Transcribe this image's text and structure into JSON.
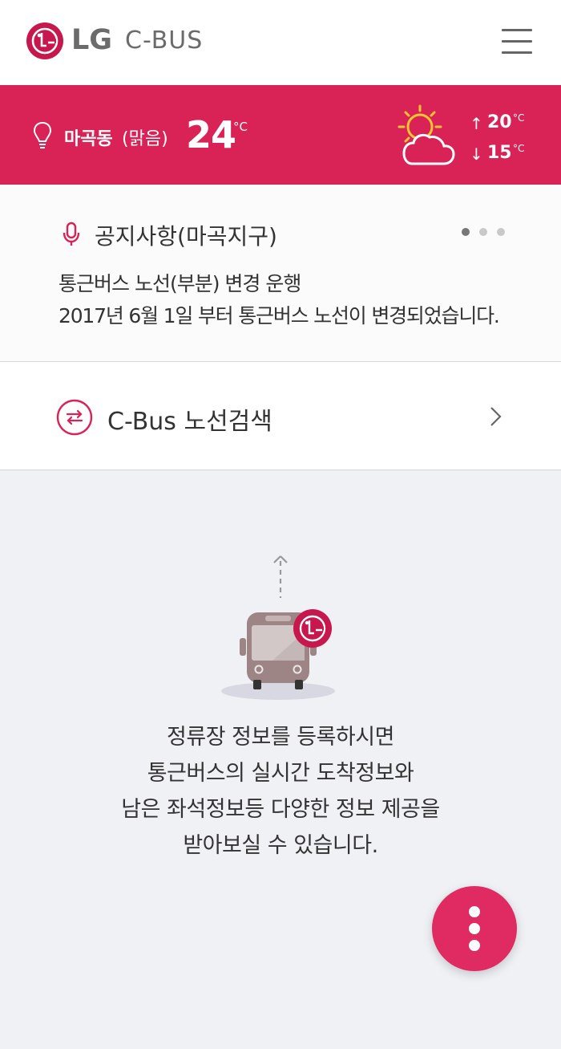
{
  "header": {
    "brand": "LG",
    "app_name": "C-BUS"
  },
  "weather": {
    "location": "마곡동",
    "condition": "(맑음)",
    "temperature": "24",
    "unit": "°C",
    "high": "20",
    "low": "15",
    "high_arrow": "↑",
    "low_arrow": "↓",
    "icon": "partly-cloudy-icon"
  },
  "notice": {
    "title": "공지사항(마곡지구)",
    "line1": "통근버스 노선(부분) 변경 운행",
    "line2": "2017년 6월 1일 부터 통근버스 노선이 변경되었습니다.",
    "pages": 3,
    "active_page": 1
  },
  "route_search": {
    "label": "C-Bus 노선검색"
  },
  "empty_state": {
    "line1": "정류장 정보를 등록하시면",
    "line2": "통근버스의 실시간 도착정보와",
    "line3": "남은 좌석정보등 다양한 정보 제공을",
    "line4": "받아보실 수 있습니다."
  },
  "colors": {
    "accent": "#d92256",
    "fab": "#e02a62",
    "bus": "#9c8584"
  }
}
